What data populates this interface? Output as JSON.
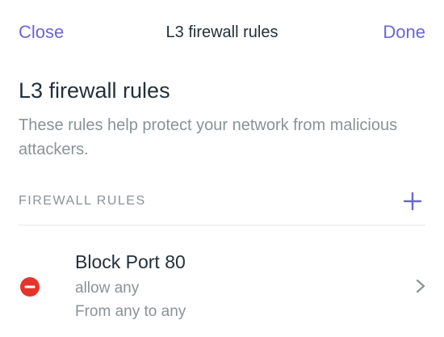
{
  "nav": {
    "close_label": "Close",
    "title": "L3 firewall rules",
    "done_label": "Done"
  },
  "page": {
    "heading": "L3 firewall rules",
    "description": "These rules help protect your network from malicious attackers."
  },
  "section": {
    "header": "FIREWALL RULES",
    "add_icon": "plus-icon"
  },
  "rules": [
    {
      "name": "Block Port 80",
      "action": "allow any",
      "scope": "From any to any",
      "delete_icon": "remove-circle-icon",
      "disclosure_icon": "chevron-right-icon"
    }
  ],
  "colors": {
    "accent": "#6a67d2",
    "delete": "#e5342b",
    "secondary_text": "#8a9296",
    "primary_text": "#22303a"
  }
}
